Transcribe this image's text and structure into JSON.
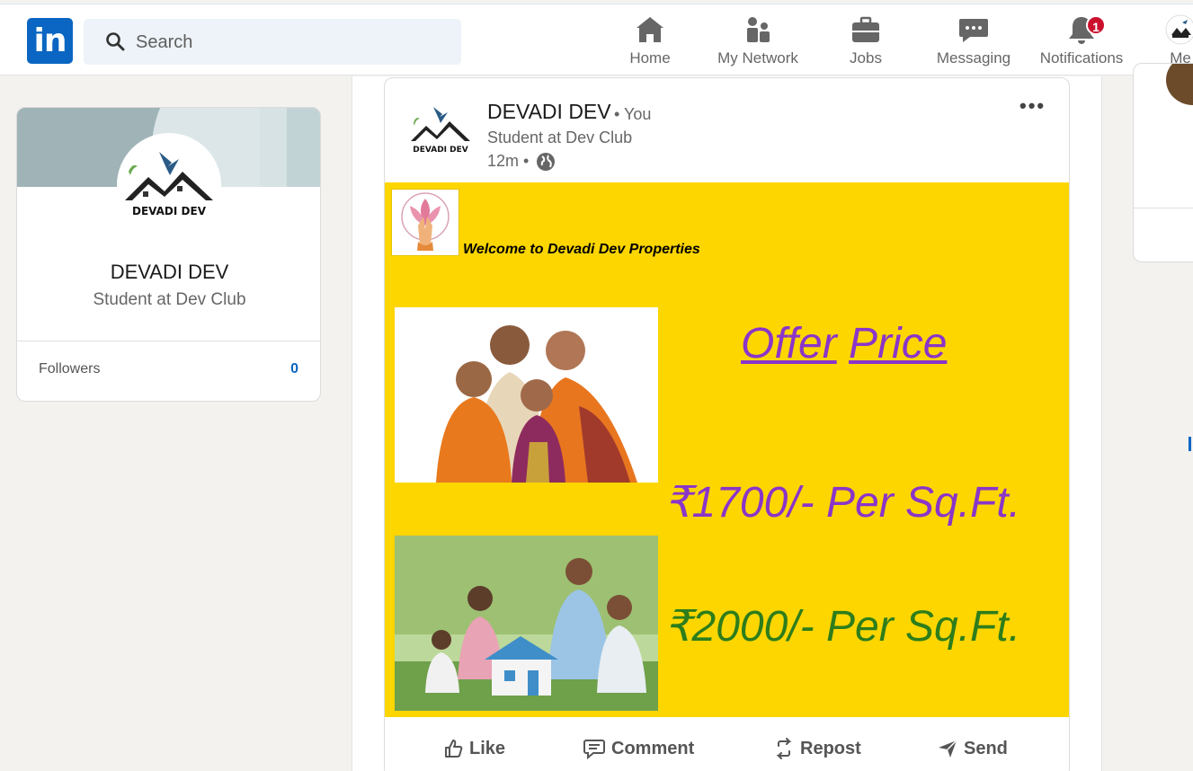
{
  "nav": {
    "logo_text": "in",
    "search_placeholder": "Search",
    "items": [
      {
        "label": "Home",
        "icon": "home-icon"
      },
      {
        "label": "My Network",
        "icon": "network-icon"
      },
      {
        "label": "Jobs",
        "icon": "briefcase-icon"
      },
      {
        "label": "Messaging",
        "icon": "messaging-icon"
      },
      {
        "label": "Notifications",
        "icon": "bell-icon",
        "badge": "1"
      },
      {
        "label": "Me",
        "icon": "me-avatar"
      }
    ]
  },
  "profile": {
    "name": "DEVADI DEV",
    "headline": "Student at Dev Club",
    "followers_label": "Followers",
    "followers_count": "0"
  },
  "post": {
    "author": "DEVADI DEV",
    "relation": "• You",
    "headline": "Student at Dev Club",
    "time": "12m •",
    "banner": {
      "welcome": "Welcome to Devadi Dev Properties",
      "offer_word1": "Offer",
      "offer_word2": "Price",
      "price1": "₹1700/- Per Sq.Ft.",
      "price2": "₹2000/- Per Sq.Ft."
    },
    "actions": {
      "like": "Like",
      "comment": "Comment",
      "repost": "Repost",
      "send": "Send"
    }
  },
  "colors": {
    "brand": "#0a66c2",
    "banner_bg": "#fdd600",
    "offer_purple": "#8a35c9",
    "price_green": "#2e7d1b",
    "badge_red": "#cb112d"
  }
}
